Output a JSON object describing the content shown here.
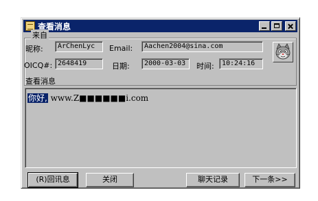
{
  "window": {
    "title": "查看消息"
  },
  "sender": {
    "group_label": "来自",
    "nickname_label": "昵称:",
    "nickname": "ArChenLyc",
    "email_label": "Email:",
    "email": "Aachen2004@sina.com",
    "oicq_label": "OICQ#:",
    "oicq": "2648419",
    "date_label": "日期:",
    "date": "2000-03-03",
    "time_label": "时间:",
    "time": "10:24:16"
  },
  "message": {
    "section_label": "查看消息",
    "greeting": "你好,",
    "text": " www.Z■■■■■■i.com"
  },
  "buttons": {
    "reply": "(R)回讯息",
    "close": "关闭",
    "chat_log": "聊天记录",
    "next": "下一条>>"
  },
  "icons": {
    "app": "message-app-icon",
    "avatar": "cat-face-avatar-icon"
  },
  "colors": {
    "titlebar": "#0a246a",
    "window_bg": "#c0c0c0",
    "selection": "#0a246a"
  }
}
